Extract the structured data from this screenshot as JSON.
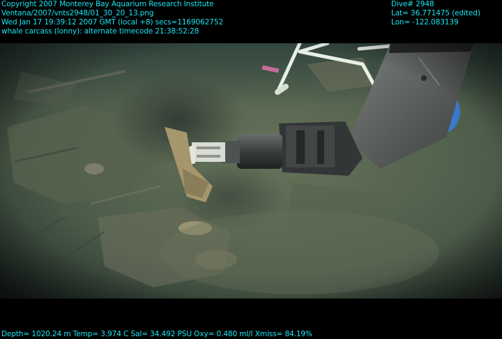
{
  "overlay": {
    "top_left": [
      "Copyright 2007 Monterey Bay Aquarium Research Institute",
      "Ventana/2007/vnts2948/01_30_20_13.png",
      "Wed Jan 17 19:39:12 2007 GMT (local +8)  secs=1169062752",
      "whale carcass (lonny): alternate timecode 21:38:52:28"
    ],
    "top_right": [
      "Dive# 2948",
      "Lat= 36.771475 (edited)",
      "Lon= -122.083139"
    ],
    "bottom": "Depth= 1020.24 m  Temp= 3.974 C  Sal= 34.492 PSU  Oxy= 0.480 ml/l  Xmiss= 84.19%",
    "text_color": "#19e6f2"
  },
  "scene": {
    "subject": "ROV manipulator arm sampling whale carcass on seafloor",
    "colors": {
      "water": "#3f5a4e",
      "sediment": "#5c6a52",
      "arm": "#3a3d3e",
      "pipe": "#e8efe6",
      "bucket": "#3a78c8"
    }
  }
}
